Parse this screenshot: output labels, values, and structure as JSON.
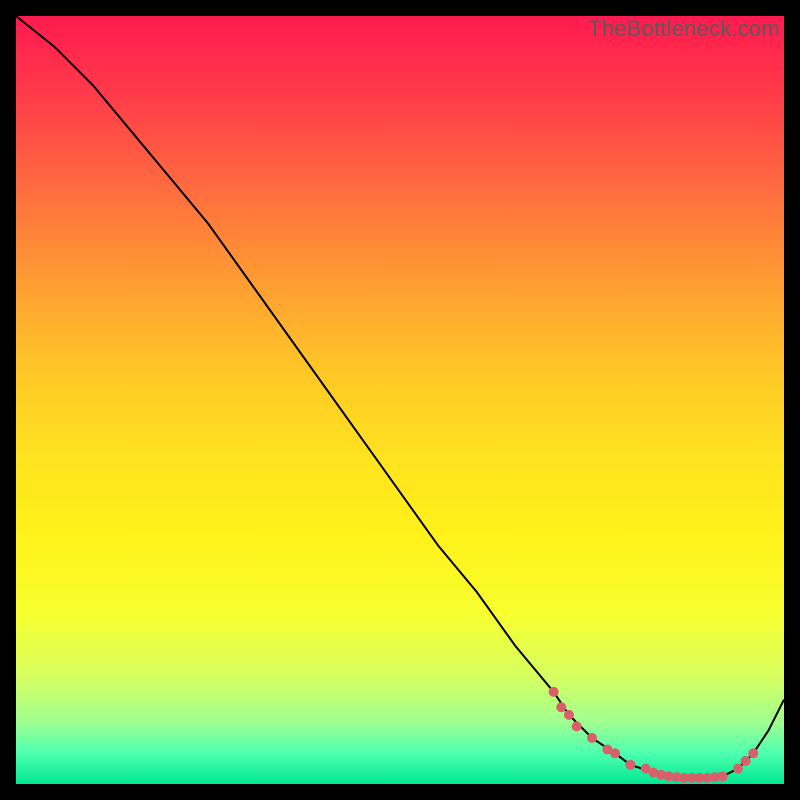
{
  "watermark": "TheBottleneck.com",
  "chart_data": {
    "type": "line",
    "title": "",
    "xlabel": "",
    "ylabel": "",
    "xlim": [
      0,
      100
    ],
    "ylim": [
      0,
      100
    ],
    "grid": false,
    "legend": false,
    "series": [
      {
        "name": "curve",
        "x": [
          0,
          5,
          10,
          15,
          20,
          25,
          30,
          35,
          40,
          45,
          50,
          55,
          60,
          65,
          70,
          72,
          75,
          78,
          80,
          83,
          85,
          88,
          90,
          92,
          94,
          96,
          98,
          100
        ],
        "y": [
          100,
          96,
          91,
          85,
          79,
          73,
          66,
          59,
          52,
          45,
          38,
          31,
          25,
          18,
          12,
          9,
          6,
          4,
          2.5,
          1.5,
          1,
          0.8,
          0.8,
          1,
          2,
          4,
          7,
          11
        ]
      }
    ],
    "points": {
      "name": "dots",
      "x": [
        70,
        71,
        72,
        73,
        75,
        77,
        78,
        80,
        82,
        83,
        84,
        85,
        86,
        87,
        88,
        89,
        90,
        91,
        92,
        94,
        95,
        96
      ],
      "y": [
        12,
        10,
        9,
        7.5,
        6,
        4.5,
        4,
        2.5,
        2,
        1.5,
        1.2,
        1,
        0.9,
        0.8,
        0.8,
        0.8,
        0.8,
        0.9,
        1,
        2,
        3,
        4
      ]
    },
    "colors": {
      "curve": "#000000",
      "dots": "#d9606a",
      "gradient_top": "#ff1a4f",
      "gradient_mid": "#ffe41f",
      "gradient_bottom": "#00e890"
    }
  }
}
